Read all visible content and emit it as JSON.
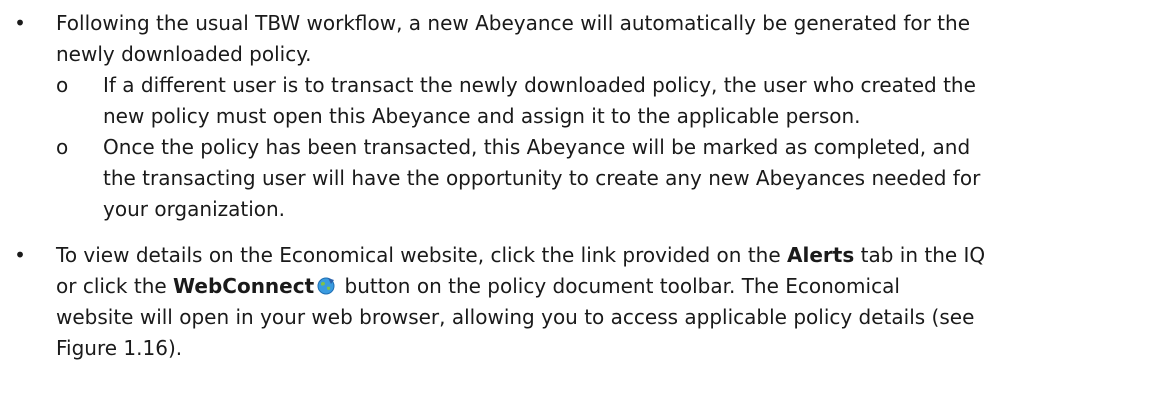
{
  "bullet_glyph": "•",
  "sub_glyph": "o",
  "item1": {
    "lines": [
      "Following the usual TBW workflow, a new Abeyance will automatically be generated for the",
      "newly downloaded policy."
    ],
    "subitems": [
      {
        "lines": [
          "If a different user is to transact the newly downloaded policy, the user who created the",
          "new policy must open this Abeyance and assign it to the applicable person."
        ]
      },
      {
        "lines": [
          "Once the policy has been transacted, this Abeyance will be marked as completed, and",
          "the transacting user will have the opportunity to create any new Abeyances needed for",
          "your organization."
        ]
      }
    ]
  },
  "item2": {
    "l1_a": "To view details on the Economical website, click the link provided on the ",
    "l1_bold": "Alerts",
    "l1_b": " tab in the IQ",
    "l2_a": "or click the ",
    "l2_bold": "WebConnect",
    "l2_b": " button on the policy document toolbar. The Economical",
    "l3": "website will open in your web browser, allowing you to access applicable policy details (see",
    "l4": "Figure 1.16).",
    "icon": "webconnect-globe-icon",
    "icon_colors": {
      "globe": "#3a9be0",
      "land": "#7ec24a",
      "arrow": "#2a5fa8"
    }
  }
}
